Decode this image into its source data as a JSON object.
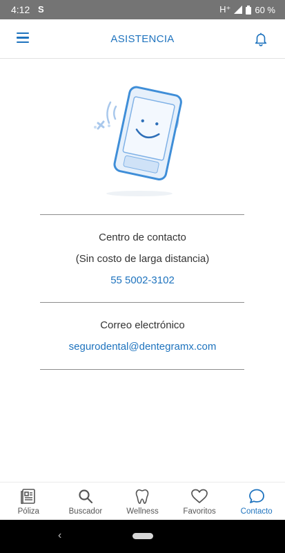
{
  "status_bar": {
    "time": "4:12",
    "network": "H⁺",
    "battery": "60 %"
  },
  "header": {
    "title": "ASISTENCIA"
  },
  "contact": {
    "center_label": "Centro de contacto",
    "center_note": "(Sin costo de larga distancia)",
    "phone": "55 5002-3102",
    "email_label": "Correo electrónico",
    "email": "segurodental@dentegramx.com"
  },
  "nav": {
    "items": [
      {
        "label": "Póliza",
        "icon": "document-icon"
      },
      {
        "label": "Buscador",
        "icon": "search-icon"
      },
      {
        "label": "Wellness",
        "icon": "tooth-icon"
      },
      {
        "label": "Favoritos",
        "icon": "heart-icon"
      },
      {
        "label": "Contacto",
        "icon": "chat-icon"
      }
    ],
    "active": "Contacto"
  },
  "colors": {
    "accent": "#1e73be",
    "status_bar": "#747474",
    "divider": "#8c8c8c"
  }
}
